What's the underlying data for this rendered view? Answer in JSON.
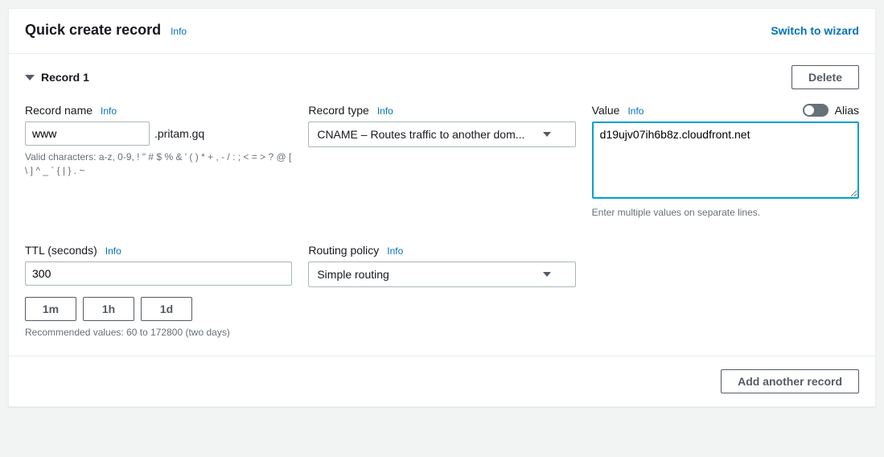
{
  "header": {
    "title": "Quick create record",
    "info": "Info",
    "switch": "Switch to wizard"
  },
  "record": {
    "label": "Record 1",
    "delete": "Delete"
  },
  "recordName": {
    "label": "Record name",
    "info": "Info",
    "value": "www",
    "suffix": ".pritam.gq",
    "hint": "Valid characters: a-z, 0-9, ! \" # $ % & ' ( ) * + , - / : ; < = > ? @ [ \\ ] ^ _ ` { | } . ~"
  },
  "recordType": {
    "label": "Record type",
    "info": "Info",
    "value": "CNAME – Routes traffic to another dom..."
  },
  "valueField": {
    "label": "Value",
    "info": "Info",
    "aliasLabel": "Alias",
    "value": "d19ujv07ih6b8z.cloudfront.net",
    "hint": "Enter multiple values on separate lines."
  },
  "ttl": {
    "label": "TTL (seconds)",
    "info": "Info",
    "value": "300",
    "presets": [
      "1m",
      "1h",
      "1d"
    ],
    "hint": "Recommended values: 60 to 172800 (two days)"
  },
  "routing": {
    "label": "Routing policy",
    "info": "Info",
    "value": "Simple routing"
  },
  "footer": {
    "addAnother": "Add another record"
  }
}
